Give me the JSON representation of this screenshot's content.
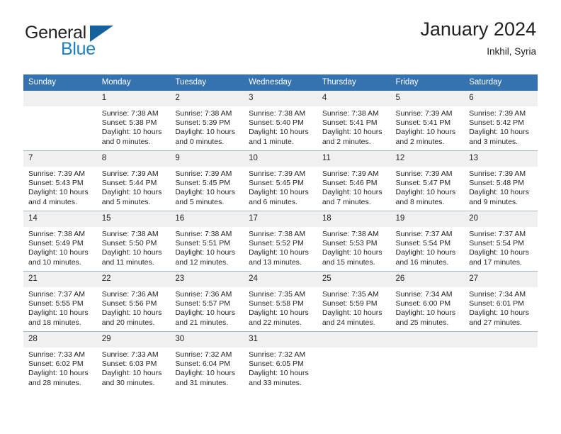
{
  "brand": {
    "name_part1": "General",
    "name_part2": "Blue",
    "triangle_color": "#14619e",
    "blue_color": "#1f7fc4"
  },
  "header": {
    "title": "January 2024",
    "subtitle": "Inkhil, Syria"
  },
  "theme": {
    "header_row_bg": "#3572b0",
    "daynum_bg": "#f0f0f0",
    "row_divider": "#a8b8c8",
    "text": "#231f20"
  },
  "weekday_headers": [
    "Sunday",
    "Monday",
    "Tuesday",
    "Wednesday",
    "Thursday",
    "Friday",
    "Saturday"
  ],
  "weeks": [
    [
      {
        "day": "",
        "blank": true,
        "sunrise": "",
        "sunset": "",
        "daylight_line1": "",
        "daylight_line2": ""
      },
      {
        "day": "1",
        "sunrise": "Sunrise: 7:38 AM",
        "sunset": "Sunset: 5:38 PM",
        "daylight_line1": "Daylight: 10 hours",
        "daylight_line2": "and 0 minutes."
      },
      {
        "day": "2",
        "sunrise": "Sunrise: 7:38 AM",
        "sunset": "Sunset: 5:39 PM",
        "daylight_line1": "Daylight: 10 hours",
        "daylight_line2": "and 0 minutes."
      },
      {
        "day": "3",
        "sunrise": "Sunrise: 7:38 AM",
        "sunset": "Sunset: 5:40 PM",
        "daylight_line1": "Daylight: 10 hours",
        "daylight_line2": "and 1 minute."
      },
      {
        "day": "4",
        "sunrise": "Sunrise: 7:38 AM",
        "sunset": "Sunset: 5:41 PM",
        "daylight_line1": "Daylight: 10 hours",
        "daylight_line2": "and 2 minutes."
      },
      {
        "day": "5",
        "sunrise": "Sunrise: 7:39 AM",
        "sunset": "Sunset: 5:41 PM",
        "daylight_line1": "Daylight: 10 hours",
        "daylight_line2": "and 2 minutes."
      },
      {
        "day": "6",
        "sunrise": "Sunrise: 7:39 AM",
        "sunset": "Sunset: 5:42 PM",
        "daylight_line1": "Daylight: 10 hours",
        "daylight_line2": "and 3 minutes."
      }
    ],
    [
      {
        "day": "7",
        "sunrise": "Sunrise: 7:39 AM",
        "sunset": "Sunset: 5:43 PM",
        "daylight_line1": "Daylight: 10 hours",
        "daylight_line2": "and 4 minutes."
      },
      {
        "day": "8",
        "sunrise": "Sunrise: 7:39 AM",
        "sunset": "Sunset: 5:44 PM",
        "daylight_line1": "Daylight: 10 hours",
        "daylight_line2": "and 5 minutes."
      },
      {
        "day": "9",
        "sunrise": "Sunrise: 7:39 AM",
        "sunset": "Sunset: 5:45 PM",
        "daylight_line1": "Daylight: 10 hours",
        "daylight_line2": "and 5 minutes."
      },
      {
        "day": "10",
        "sunrise": "Sunrise: 7:39 AM",
        "sunset": "Sunset: 5:45 PM",
        "daylight_line1": "Daylight: 10 hours",
        "daylight_line2": "and 6 minutes."
      },
      {
        "day": "11",
        "sunrise": "Sunrise: 7:39 AM",
        "sunset": "Sunset: 5:46 PM",
        "daylight_line1": "Daylight: 10 hours",
        "daylight_line2": "and 7 minutes."
      },
      {
        "day": "12",
        "sunrise": "Sunrise: 7:39 AM",
        "sunset": "Sunset: 5:47 PM",
        "daylight_line1": "Daylight: 10 hours",
        "daylight_line2": "and 8 minutes."
      },
      {
        "day": "13",
        "sunrise": "Sunrise: 7:39 AM",
        "sunset": "Sunset: 5:48 PM",
        "daylight_line1": "Daylight: 10 hours",
        "daylight_line2": "and 9 minutes."
      }
    ],
    [
      {
        "day": "14",
        "sunrise": "Sunrise: 7:38 AM",
        "sunset": "Sunset: 5:49 PM",
        "daylight_line1": "Daylight: 10 hours",
        "daylight_line2": "and 10 minutes."
      },
      {
        "day": "15",
        "sunrise": "Sunrise: 7:38 AM",
        "sunset": "Sunset: 5:50 PM",
        "daylight_line1": "Daylight: 10 hours",
        "daylight_line2": "and 11 minutes."
      },
      {
        "day": "16",
        "sunrise": "Sunrise: 7:38 AM",
        "sunset": "Sunset: 5:51 PM",
        "daylight_line1": "Daylight: 10 hours",
        "daylight_line2": "and 12 minutes."
      },
      {
        "day": "17",
        "sunrise": "Sunrise: 7:38 AM",
        "sunset": "Sunset: 5:52 PM",
        "daylight_line1": "Daylight: 10 hours",
        "daylight_line2": "and 13 minutes."
      },
      {
        "day": "18",
        "sunrise": "Sunrise: 7:38 AM",
        "sunset": "Sunset: 5:53 PM",
        "daylight_line1": "Daylight: 10 hours",
        "daylight_line2": "and 15 minutes."
      },
      {
        "day": "19",
        "sunrise": "Sunrise: 7:37 AM",
        "sunset": "Sunset: 5:54 PM",
        "daylight_line1": "Daylight: 10 hours",
        "daylight_line2": "and 16 minutes."
      },
      {
        "day": "20",
        "sunrise": "Sunrise: 7:37 AM",
        "sunset": "Sunset: 5:54 PM",
        "daylight_line1": "Daylight: 10 hours",
        "daylight_line2": "and 17 minutes."
      }
    ],
    [
      {
        "day": "21",
        "sunrise": "Sunrise: 7:37 AM",
        "sunset": "Sunset: 5:55 PM",
        "daylight_line1": "Daylight: 10 hours",
        "daylight_line2": "and 18 minutes."
      },
      {
        "day": "22",
        "sunrise": "Sunrise: 7:36 AM",
        "sunset": "Sunset: 5:56 PM",
        "daylight_line1": "Daylight: 10 hours",
        "daylight_line2": "and 20 minutes."
      },
      {
        "day": "23",
        "sunrise": "Sunrise: 7:36 AM",
        "sunset": "Sunset: 5:57 PM",
        "daylight_line1": "Daylight: 10 hours",
        "daylight_line2": "and 21 minutes."
      },
      {
        "day": "24",
        "sunrise": "Sunrise: 7:35 AM",
        "sunset": "Sunset: 5:58 PM",
        "daylight_line1": "Daylight: 10 hours",
        "daylight_line2": "and 22 minutes."
      },
      {
        "day": "25",
        "sunrise": "Sunrise: 7:35 AM",
        "sunset": "Sunset: 5:59 PM",
        "daylight_line1": "Daylight: 10 hours",
        "daylight_line2": "and 24 minutes."
      },
      {
        "day": "26",
        "sunrise": "Sunrise: 7:34 AM",
        "sunset": "Sunset: 6:00 PM",
        "daylight_line1": "Daylight: 10 hours",
        "daylight_line2": "and 25 minutes."
      },
      {
        "day": "27",
        "sunrise": "Sunrise: 7:34 AM",
        "sunset": "Sunset: 6:01 PM",
        "daylight_line1": "Daylight: 10 hours",
        "daylight_line2": "and 27 minutes."
      }
    ],
    [
      {
        "day": "28",
        "sunrise": "Sunrise: 7:33 AM",
        "sunset": "Sunset: 6:02 PM",
        "daylight_line1": "Daylight: 10 hours",
        "daylight_line2": "and 28 minutes."
      },
      {
        "day": "29",
        "sunrise": "Sunrise: 7:33 AM",
        "sunset": "Sunset: 6:03 PM",
        "daylight_line1": "Daylight: 10 hours",
        "daylight_line2": "and 30 minutes."
      },
      {
        "day": "30",
        "sunrise": "Sunrise: 7:32 AM",
        "sunset": "Sunset: 6:04 PM",
        "daylight_line1": "Daylight: 10 hours",
        "daylight_line2": "and 31 minutes."
      },
      {
        "day": "31",
        "sunrise": "Sunrise: 7:32 AM",
        "sunset": "Sunset: 6:05 PM",
        "daylight_line1": "Daylight: 10 hours",
        "daylight_line2": "and 33 minutes."
      },
      {
        "day": "",
        "blank": true,
        "sunrise": "",
        "sunset": "",
        "daylight_line1": "",
        "daylight_line2": ""
      },
      {
        "day": "",
        "blank": true,
        "sunrise": "",
        "sunset": "",
        "daylight_line1": "",
        "daylight_line2": ""
      },
      {
        "day": "",
        "blank": true,
        "sunrise": "",
        "sunset": "",
        "daylight_line1": "",
        "daylight_line2": ""
      }
    ]
  ]
}
